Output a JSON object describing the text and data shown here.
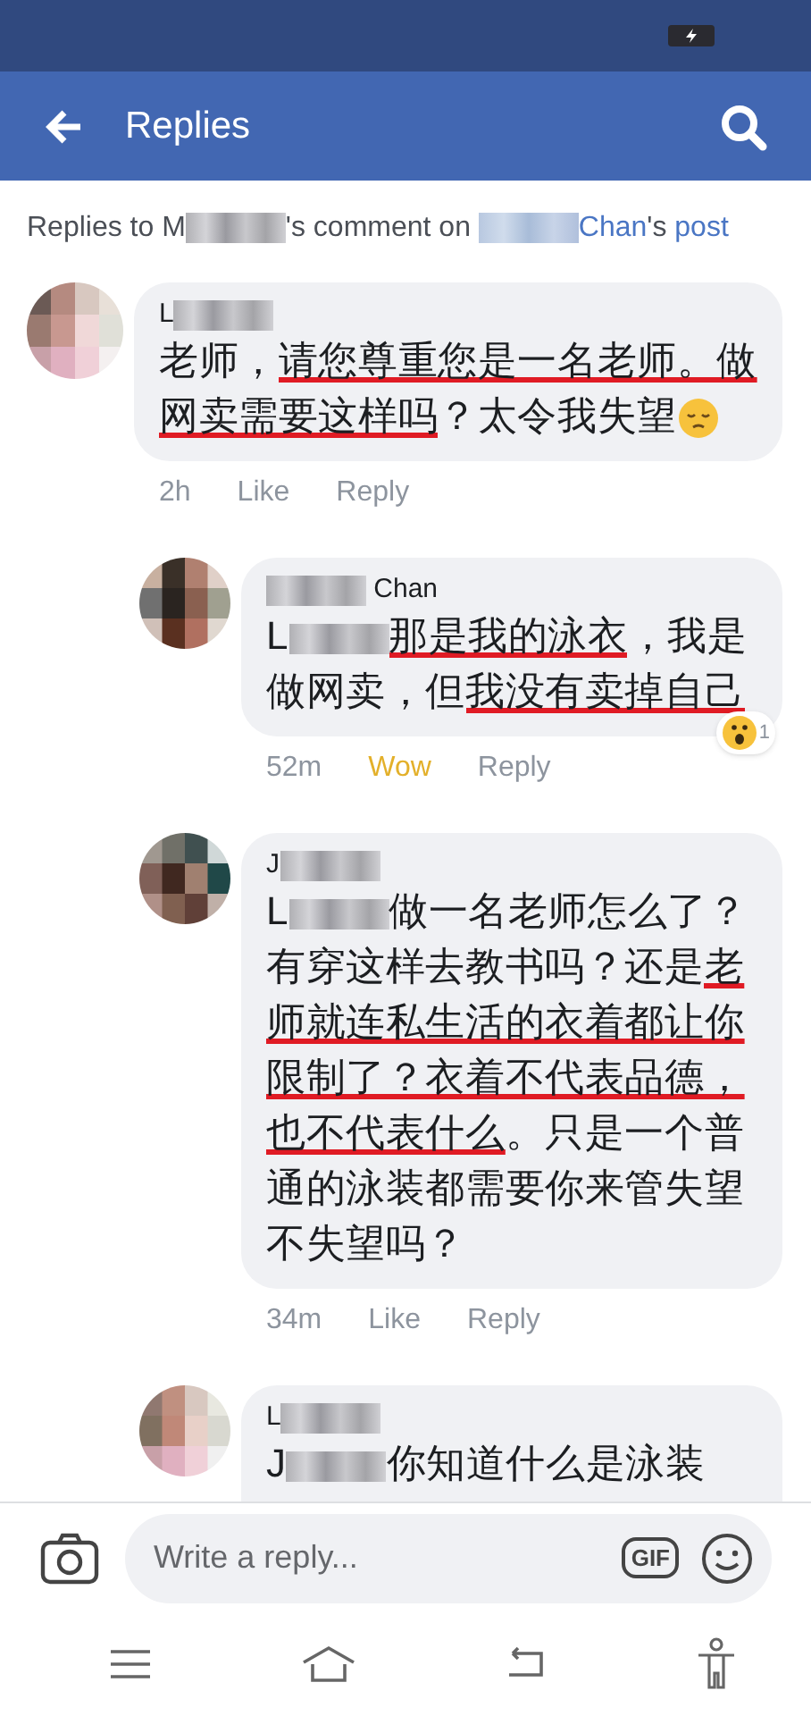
{
  "header": {
    "title": "Replies"
  },
  "context": [
    {
      "kind": "text",
      "text": "Replies to M"
    },
    {
      "kind": "blur"
    },
    {
      "kind": "text",
      "text": "'s comment on "
    },
    {
      "kind": "blur"
    },
    {
      "kind": "link",
      "text": "Chan"
    },
    {
      "kind": "text",
      "text": "'s "
    },
    {
      "kind": "link",
      "text": "post"
    }
  ],
  "comment": {
    "author": [
      {
        "kind": "text",
        "text": "L"
      },
      {
        "kind": "blur"
      }
    ],
    "body": [
      {
        "kind": "text",
        "text": "老师，",
        "underlined": false
      },
      {
        "kind": "text",
        "text": "请您尊重您是一名老师。做网卖需要这样吗",
        "underlined": true
      },
      {
        "kind": "text",
        "text": "？太令我失望",
        "underlined": false
      },
      {
        "kind": "emoji"
      }
    ],
    "time": "2h",
    "reaction": {
      "label": "Like",
      "reacted": false
    },
    "reply": "Reply",
    "replies": [
      {
        "author": [
          {
            "kind": "blur"
          },
          {
            "kind": "text",
            "text": " Chan"
          }
        ],
        "body": [
          {
            "kind": "text",
            "text": "L",
            "underlined": false
          },
          {
            "kind": "blur"
          },
          {
            "kind": "text",
            "text": "那是我的泳衣",
            "underlined": true
          },
          {
            "kind": "text",
            "text": "，我是做网卖，但",
            "underlined": false
          },
          {
            "kind": "text",
            "text": "我没有卖掉自己",
            "underlined": true
          }
        ],
        "time": "52m",
        "reaction": {
          "label": "Wow",
          "reacted": true
        },
        "reply": "Reply",
        "badge": {
          "count": "1"
        }
      },
      {
        "author": [
          {
            "kind": "text",
            "text": "J"
          },
          {
            "kind": "blur"
          }
        ],
        "body": [
          {
            "kind": "text",
            "text": "L",
            "underlined": false
          },
          {
            "kind": "blur"
          },
          {
            "kind": "text",
            "text": "做一名老师怎么了？有穿这样去教书吗？还是",
            "underlined": false
          },
          {
            "kind": "text",
            "text": "老师就连私生活的衣着都让你限制了？衣着不代表品德，也不代表什么",
            "underlined": true
          },
          {
            "kind": "text",
            "text": "。只是一个普通的泳装都需要你来管失望不失望吗？",
            "underlined": false
          }
        ],
        "time": "34m",
        "reaction": {
          "label": "Like",
          "reacted": false
        },
        "reply": "Reply"
      },
      {
        "author": [
          {
            "kind": "text",
            "text": "L"
          },
          {
            "kind": "blur"
          }
        ],
        "body": [
          {
            "kind": "text",
            "text": "J",
            "underlined": false
          },
          {
            "kind": "blur"
          },
          {
            "kind": "text",
            "text": "你知道什么是泳装",
            "underlined": false
          }
        ]
      }
    ]
  },
  "composer": {
    "placeholder": "Write a reply...",
    "gif": "GIF"
  }
}
